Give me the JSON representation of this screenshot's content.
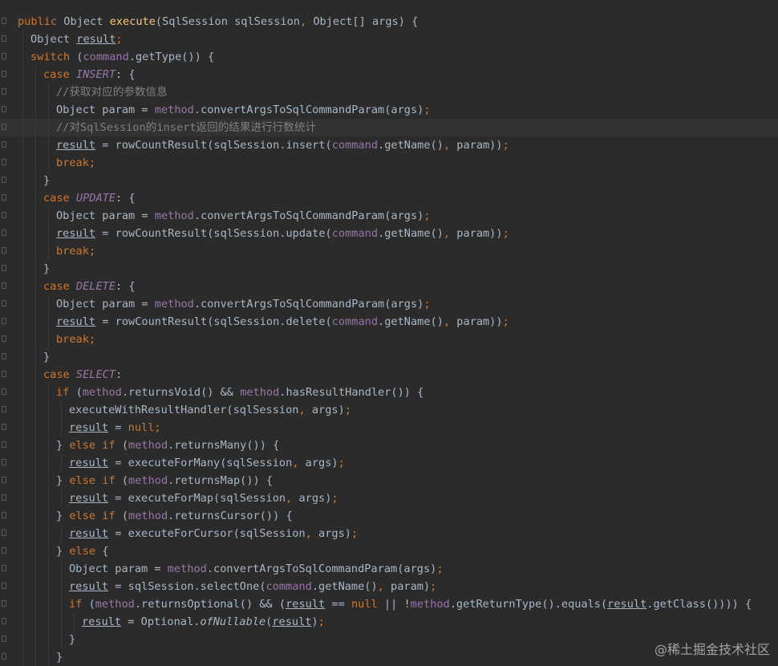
{
  "editor": {
    "language": "java",
    "theme_colors": {
      "background": "#2b2b2b",
      "keyword": "#cc7832",
      "method_decl": "#ffc66d",
      "field": "#9876aa",
      "comment": "#808080",
      "default": "#a9b7c6"
    },
    "lines": [
      {
        "indent": 0,
        "tokens": [
          [
            "kw",
            "public "
          ],
          [
            "",
            "Object "
          ],
          [
            "fn",
            "execute"
          ],
          [
            "",
            "(SqlSession sqlSession"
          ],
          [
            "kw",
            ", "
          ],
          [
            "",
            "Object[] args) {"
          ]
        ]
      },
      {
        "indent": 1,
        "tokens": [
          [
            "",
            "Object "
          ],
          [
            "ul",
            "result"
          ],
          [
            "kw",
            ";"
          ]
        ]
      },
      {
        "indent": 1,
        "tokens": [
          [
            "kw",
            "switch "
          ],
          [
            "",
            "("
          ],
          [
            "fld",
            "command"
          ],
          [
            "",
            ".getType()) {"
          ]
        ]
      },
      {
        "indent": 2,
        "tokens": [
          [
            "kw",
            "case "
          ],
          [
            "cst",
            "INSERT"
          ],
          [
            "",
            ": {"
          ]
        ]
      },
      {
        "indent": 3,
        "tokens": [
          [
            "cm",
            "//获取对应的参数信息"
          ]
        ]
      },
      {
        "indent": 3,
        "tokens": [
          [
            "",
            "Object param = "
          ],
          [
            "fld",
            "method"
          ],
          [
            "",
            ".convertArgsToSqlCommandParam(args)"
          ],
          [
            "kw",
            ";"
          ]
        ]
      },
      {
        "indent": 3,
        "highlight": true,
        "tokens": [
          [
            "cm",
            "//对SqlSession的insert返回的结果进行行数统计"
          ]
        ]
      },
      {
        "indent": 3,
        "tokens": [
          [
            "ul",
            "result"
          ],
          [
            "",
            " = rowCountResult(sqlSession.insert("
          ],
          [
            "fld",
            "command"
          ],
          [
            "",
            ".getName()"
          ],
          [
            "kw",
            ", "
          ],
          [
            "",
            "param))"
          ],
          [
            "kw",
            ";"
          ]
        ]
      },
      {
        "indent": 3,
        "tokens": [
          [
            "kw",
            "break;"
          ]
        ]
      },
      {
        "indent": 2,
        "tokens": [
          [
            "",
            "}"
          ]
        ]
      },
      {
        "indent": 2,
        "tokens": [
          [
            "kw",
            "case "
          ],
          [
            "cst",
            "UPDATE"
          ],
          [
            "",
            ": {"
          ]
        ]
      },
      {
        "indent": 3,
        "tokens": [
          [
            "",
            "Object param = "
          ],
          [
            "fld",
            "method"
          ],
          [
            "",
            ".convertArgsToSqlCommandParam(args)"
          ],
          [
            "kw",
            ";"
          ]
        ]
      },
      {
        "indent": 3,
        "tokens": [
          [
            "ul",
            "result"
          ],
          [
            "",
            " = rowCountResult(sqlSession.update("
          ],
          [
            "fld",
            "command"
          ],
          [
            "",
            ".getName()"
          ],
          [
            "kw",
            ", "
          ],
          [
            "",
            "param))"
          ],
          [
            "kw",
            ";"
          ]
        ]
      },
      {
        "indent": 3,
        "tokens": [
          [
            "kw",
            "break;"
          ]
        ]
      },
      {
        "indent": 2,
        "tokens": [
          [
            "",
            "}"
          ]
        ]
      },
      {
        "indent": 2,
        "tokens": [
          [
            "kw",
            "case "
          ],
          [
            "cst",
            "DELETE"
          ],
          [
            "",
            ": {"
          ]
        ]
      },
      {
        "indent": 3,
        "tokens": [
          [
            "",
            "Object param = "
          ],
          [
            "fld",
            "method"
          ],
          [
            "",
            ".convertArgsToSqlCommandParam(args)"
          ],
          [
            "kw",
            ";"
          ]
        ]
      },
      {
        "indent": 3,
        "tokens": [
          [
            "ul",
            "result"
          ],
          [
            "",
            " = rowCountResult(sqlSession.delete("
          ],
          [
            "fld",
            "command"
          ],
          [
            "",
            ".getName()"
          ],
          [
            "kw",
            ", "
          ],
          [
            "",
            "param))"
          ],
          [
            "kw",
            ";"
          ]
        ]
      },
      {
        "indent": 3,
        "tokens": [
          [
            "kw",
            "break;"
          ]
        ]
      },
      {
        "indent": 2,
        "tokens": [
          [
            "",
            "}"
          ]
        ]
      },
      {
        "indent": 2,
        "tokens": [
          [
            "kw",
            "case "
          ],
          [
            "cst",
            "SELECT"
          ],
          [
            "",
            ":"
          ]
        ]
      },
      {
        "indent": 3,
        "tokens": [
          [
            "kw",
            "if "
          ],
          [
            "",
            "("
          ],
          [
            "fld",
            "method"
          ],
          [
            "",
            ".returnsVoid() && "
          ],
          [
            "fld",
            "method"
          ],
          [
            "",
            ".hasResultHandler()) {"
          ]
        ]
      },
      {
        "indent": 4,
        "tokens": [
          [
            "",
            "executeWithResultHandler(sqlSession"
          ],
          [
            "kw",
            ", "
          ],
          [
            "",
            "args)"
          ],
          [
            "kw",
            ";"
          ]
        ]
      },
      {
        "indent": 4,
        "tokens": [
          [
            "ul",
            "result"
          ],
          [
            "",
            " = "
          ],
          [
            "kw",
            "null;"
          ]
        ]
      },
      {
        "indent": 3,
        "tokens": [
          [
            "",
            "} "
          ],
          [
            "kw",
            "else if "
          ],
          [
            "",
            "("
          ],
          [
            "fld",
            "method"
          ],
          [
            "",
            ".returnsMany()) {"
          ]
        ]
      },
      {
        "indent": 4,
        "tokens": [
          [
            "ul",
            "result"
          ],
          [
            "",
            " = executeForMany(sqlSession"
          ],
          [
            "kw",
            ", "
          ],
          [
            "",
            "args)"
          ],
          [
            "kw",
            ";"
          ]
        ]
      },
      {
        "indent": 3,
        "tokens": [
          [
            "",
            "} "
          ],
          [
            "kw",
            "else if "
          ],
          [
            "",
            "("
          ],
          [
            "fld",
            "method"
          ],
          [
            "",
            ".returnsMap()) {"
          ]
        ]
      },
      {
        "indent": 4,
        "tokens": [
          [
            "ul",
            "result"
          ],
          [
            "",
            " = executeForMap(sqlSession"
          ],
          [
            "kw",
            ", "
          ],
          [
            "",
            "args)"
          ],
          [
            "kw",
            ";"
          ]
        ]
      },
      {
        "indent": 3,
        "tokens": [
          [
            "",
            "} "
          ],
          [
            "kw",
            "else if "
          ],
          [
            "",
            "("
          ],
          [
            "fld",
            "method"
          ],
          [
            "",
            ".returnsCursor()) {"
          ]
        ]
      },
      {
        "indent": 4,
        "tokens": [
          [
            "ul",
            "result"
          ],
          [
            "",
            " = executeForCursor(sqlSession"
          ],
          [
            "kw",
            ", "
          ],
          [
            "",
            "args)"
          ],
          [
            "kw",
            ";"
          ]
        ]
      },
      {
        "indent": 3,
        "tokens": [
          [
            "",
            "} "
          ],
          [
            "kw",
            "else "
          ],
          [
            "",
            "{"
          ]
        ]
      },
      {
        "indent": 4,
        "tokens": [
          [
            "",
            "Object param = "
          ],
          [
            "fld",
            "method"
          ],
          [
            "",
            ".convertArgsToSqlCommandParam(args)"
          ],
          [
            "kw",
            ";"
          ]
        ]
      },
      {
        "indent": 4,
        "tokens": [
          [
            "ul",
            "result"
          ],
          [
            "",
            " = sqlSession.selectOne("
          ],
          [
            "fld",
            "command"
          ],
          [
            "",
            ".getName()"
          ],
          [
            "kw",
            ", "
          ],
          [
            "",
            "param)"
          ],
          [
            "kw",
            ";"
          ]
        ]
      },
      {
        "indent": 4,
        "tokens": [
          [
            "kw",
            "if "
          ],
          [
            "",
            "("
          ],
          [
            "fld",
            "method"
          ],
          [
            "",
            ".returnsOptional() && ("
          ],
          [
            "ul",
            "result"
          ],
          [
            "",
            " == "
          ],
          [
            "kw",
            "null "
          ],
          [
            "",
            "|| !"
          ],
          [
            "fld",
            "method"
          ],
          [
            "",
            ".getReturnType().equals("
          ],
          [
            "ul",
            "result"
          ],
          [
            "",
            ".getClass()))) {"
          ]
        ]
      },
      {
        "indent": 5,
        "tokens": [
          [
            "ul",
            "result"
          ],
          [
            "",
            " = Optional."
          ],
          [
            "it",
            "ofNullable"
          ],
          [
            "",
            "("
          ],
          [
            "ul",
            "result"
          ],
          [
            "",
            ")"
          ],
          [
            "kw",
            ";"
          ]
        ]
      },
      {
        "indent": 4,
        "tokens": [
          [
            "",
            "}"
          ]
        ]
      },
      {
        "indent": 3,
        "tokens": [
          [
            "",
            "}"
          ]
        ]
      }
    ]
  },
  "watermark": {
    "text": "@稀土掘金技术社区"
  }
}
